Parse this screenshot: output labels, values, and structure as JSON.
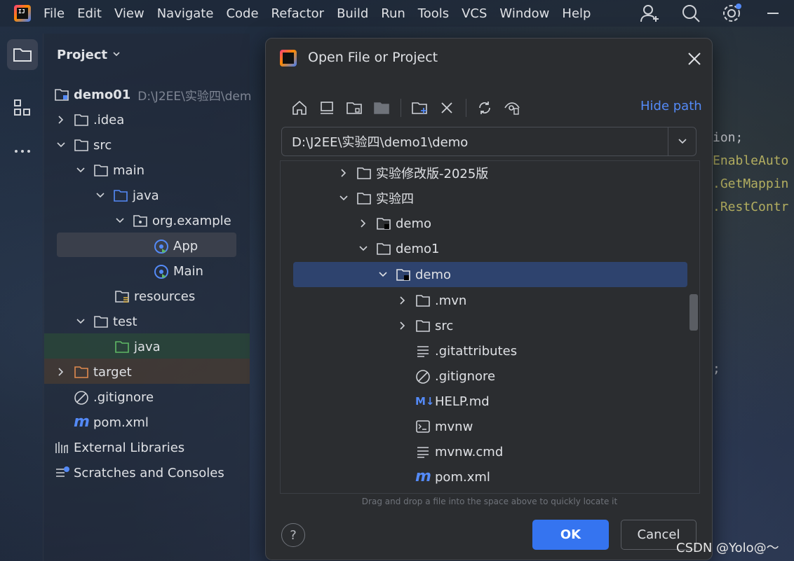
{
  "menubar": {
    "items": [
      "File",
      "Edit",
      "View",
      "Navigate",
      "Code",
      "Refactor",
      "Build",
      "Run",
      "Tools",
      "VCS",
      "Window",
      "Help"
    ],
    "right_icons": [
      "add-user-icon",
      "search-icon",
      "settings-icon"
    ]
  },
  "toolstrip": {
    "icons": [
      "folder-icon",
      "structure-icon",
      "more-icon"
    ]
  },
  "project_panel": {
    "title": "Project",
    "root": {
      "name": "demo01",
      "path": "D:\\J2EE\\实验四\\dem"
    },
    "items": [
      {
        "label": ".idea",
        "icon": "folder-icon"
      },
      {
        "label": "src",
        "icon": "folder-icon"
      },
      {
        "label": "main",
        "icon": "folder-icon"
      },
      {
        "label": "java",
        "icon": "source-folder-icon"
      },
      {
        "label": "org.example",
        "icon": "package-icon"
      },
      {
        "label": "App",
        "icon": "spring-class-icon"
      },
      {
        "label": "Main",
        "icon": "spring-class-icon"
      },
      {
        "label": "resources",
        "icon": "resources-folder-icon"
      },
      {
        "label": "test",
        "icon": "folder-icon"
      },
      {
        "label": "java",
        "icon": "test-source-folder-icon"
      },
      {
        "label": "target",
        "icon": "excluded-folder-icon"
      },
      {
        "label": ".gitignore",
        "icon": "ignore-file-icon"
      },
      {
        "label": "pom.xml",
        "icon": "maven-icon"
      },
      {
        "label": "External Libraries",
        "icon": "library-icon"
      },
      {
        "label": "Scratches and Consoles",
        "icon": "scratches-icon"
      }
    ]
  },
  "editor": {
    "lines": [
      "ion;",
      "EnableAuto",
      ".GetMappin",
      ".RestContr",
      ";"
    ]
  },
  "dialog": {
    "title": "Open File or Project",
    "hide_path_label": "Hide path",
    "path_value": "D:\\J2EE\\实验四\\demo1\\demo",
    "tree": [
      {
        "label": "实验修改版-2025版",
        "icon": "folder-icon"
      },
      {
        "label": "实验四",
        "icon": "folder-icon"
      },
      {
        "label": "demo",
        "icon": "module-folder-icon"
      },
      {
        "label": "demo1",
        "icon": "folder-icon"
      },
      {
        "label": "demo",
        "icon": "module-folder-icon"
      },
      {
        "label": ".mvn",
        "icon": "folder-icon"
      },
      {
        "label": "src",
        "icon": "folder-icon"
      },
      {
        "label": ".gitattributes",
        "icon": "text-file-icon"
      },
      {
        "label": ".gitignore",
        "icon": "ignore-file-icon"
      },
      {
        "label": "HELP.md",
        "icon": "markdown-icon"
      },
      {
        "label": "mvnw",
        "icon": "shell-script-icon"
      },
      {
        "label": "mvnw.cmd",
        "icon": "text-file-icon"
      },
      {
        "label": "pom.xml",
        "icon": "maven-icon"
      }
    ],
    "hint": "Drag and drop a file into the space above to quickly locate it",
    "help_label": "?",
    "ok_label": "OK",
    "cancel_label": "Cancel"
  },
  "watermark": "CSDN @Yolo@～",
  "colors": {
    "accent": "#3574f0",
    "link": "#548af7",
    "selection": "#2e436e",
    "dialog_bg": "#2b2d30"
  }
}
